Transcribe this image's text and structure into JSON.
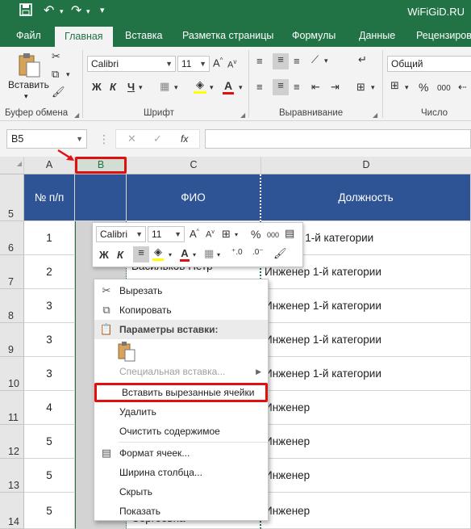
{
  "titlebar": {
    "brand": "WiFiGiD.RU"
  },
  "tabs": [
    {
      "label": "Файл"
    },
    {
      "label": "Главная"
    },
    {
      "label": "Вставка"
    },
    {
      "label": "Разметка страницы"
    },
    {
      "label": "Формулы"
    },
    {
      "label": "Данные"
    },
    {
      "label": "Рецензирова"
    }
  ],
  "ribbon": {
    "paste_label": "Вставить",
    "font_name": "Calibri",
    "font_size": "11",
    "number_format": "Общий",
    "groups": {
      "clipboard": "Буфер обмена",
      "font": "Шрифт",
      "alignment": "Выравнивание",
      "number": "Число"
    },
    "bold": "Ж",
    "italic": "К",
    "underline": "Ч",
    "percent": "%",
    "thousands": "000"
  },
  "formula_bar": {
    "name_box": "B5",
    "fx": "fx"
  },
  "columns": [
    "A",
    "B",
    "C",
    "D"
  ],
  "rows": [
    {
      "num": "5"
    },
    {
      "num": "6"
    },
    {
      "num": "7"
    },
    {
      "num": "8"
    },
    {
      "num": "9"
    },
    {
      "num": "10"
    },
    {
      "num": "11"
    },
    {
      "num": "12"
    },
    {
      "num": "13"
    },
    {
      "num": "14"
    }
  ],
  "table": {
    "header": {
      "a": "№ п/п",
      "c": "ФИО",
      "d": "Должность"
    },
    "a_values": [
      "1",
      "2",
      "3",
      "3",
      "3",
      "4",
      "5",
      "5",
      "5"
    ],
    "c_partial": {
      "r7": "Васильков Петр",
      "r14": "Сергеевна"
    },
    "d_values": [
      "нженер 1-й категории",
      "Инженер 1-й категории",
      "Инженер 1-й категории",
      "Инженер 1-й категории",
      "Инженер 1-й категории",
      "Инженер",
      "Инженер",
      "Инженер",
      "Инженер"
    ]
  },
  "mini_toolbar": {
    "font_name": "Calibri",
    "font_size": "11",
    "bold": "Ж",
    "italic": "К",
    "percent": "%",
    "thousands": "000"
  },
  "context_menu": {
    "items": [
      {
        "label": "Вырезать"
      },
      {
        "label": "Копировать"
      },
      {
        "label": "Параметры вставки:"
      },
      {
        "label": "Специальная вставка..."
      },
      {
        "label": "Вставить вырезанные ячейки"
      },
      {
        "label": "Удалить"
      },
      {
        "label": "Очистить содержимое"
      },
      {
        "label": "Формат ячеек..."
      },
      {
        "label": "Ширина столбца..."
      },
      {
        "label": "Скрыть"
      },
      {
        "label": "Показать"
      }
    ]
  },
  "colors": {
    "brand_green": "#217346",
    "header_blue": "#2f5496",
    "highlight_red": "#e01010"
  }
}
